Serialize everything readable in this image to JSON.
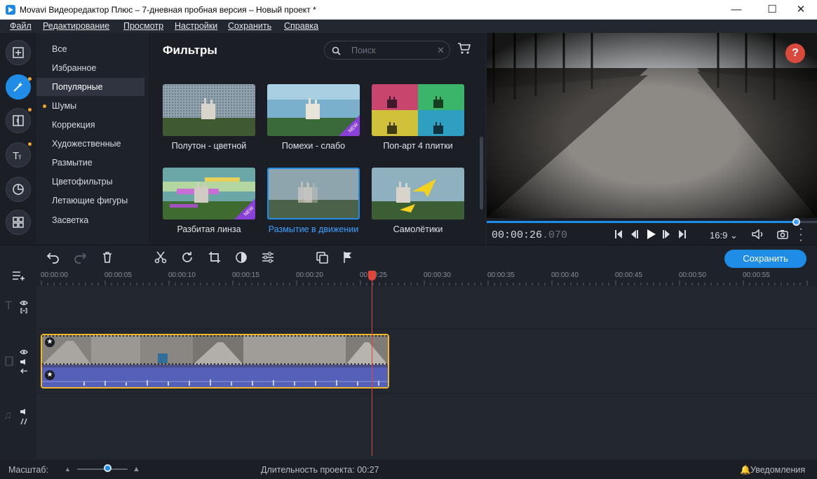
{
  "window": {
    "title": "Movavi Видеоредактор Плюс – 7-дневная пробная версия – Новый проект *",
    "minimize": "—",
    "maximize": "☐",
    "close": "✕"
  },
  "menu": [
    "Файл",
    "Редактирование",
    "Просмотр",
    "Настройки",
    "Сохранить",
    "Справка"
  ],
  "toolstrip": {
    "icons": [
      "import-icon",
      "filters-icon",
      "transitions-icon",
      "titles-icon",
      "stickers-icon",
      "more-tools-icon"
    ],
    "active_index": 1
  },
  "categories": {
    "items": [
      "Все",
      "Избранное",
      "Популярные",
      "Шумы",
      "Коррекция",
      "Художественные",
      "Размытие",
      "Цветофильтры",
      "Летающие фигуры",
      "Засветка"
    ],
    "selected_index": 2
  },
  "filters": {
    "title": "Фильтры",
    "search_placeholder": "Поиск",
    "items": [
      {
        "label": "Полутон - цветной",
        "new": false
      },
      {
        "label": "Помехи - слабо",
        "new": true
      },
      {
        "label": "Поп-арт 4 плитки",
        "new": false
      },
      {
        "label": "Разбитая линза",
        "new": true
      },
      {
        "label": "Размытие в движении",
        "new": false,
        "selected": true
      },
      {
        "label": "Самолётики",
        "new": false
      }
    ],
    "new_badge": "NEW"
  },
  "preview": {
    "help": "?",
    "time_main": "00:00:26",
    "time_ms": ".070",
    "aspect": "16:9",
    "progress": 0.94
  },
  "timeline": {
    "save_label": "Сохранить",
    "ticks": [
      "00:00:00",
      "00:00:05",
      "00:00:10",
      "00:00:15",
      "00:00:20",
      "00:00:25",
      "00:00:30",
      "00:00:35",
      "00:00:40",
      "00:00:45",
      "00:00:50",
      "00:00:55"
    ]
  },
  "status": {
    "zoom_label": "Масштаб:",
    "duration": "Длительность проекта:  00:27",
    "notifications": "Уведомления"
  },
  "colors": {
    "accent": "#1f8ce6",
    "clip_border": "#f1b92a",
    "audio": "#5561b8",
    "playhead": "#e0453a",
    "badge": "#8b3fd9"
  }
}
